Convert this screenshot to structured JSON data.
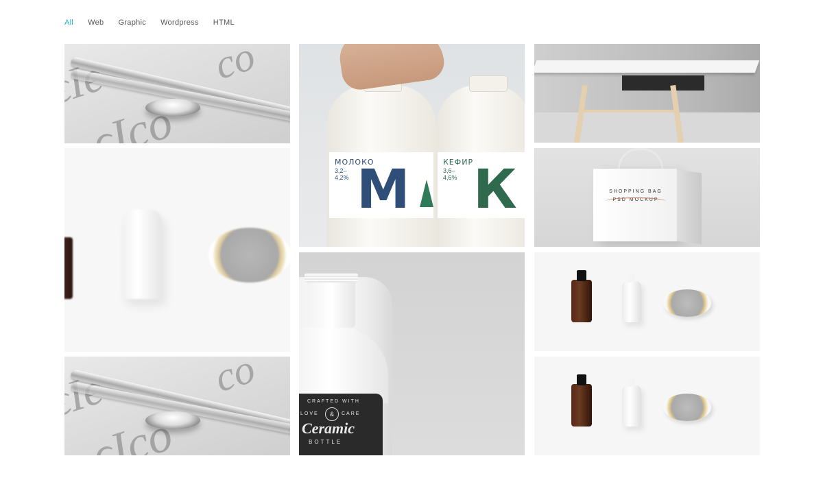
{
  "filters": [
    {
      "label": "All",
      "active": true
    },
    {
      "label": "Web",
      "active": false
    },
    {
      "label": "Graphic",
      "active": false
    },
    {
      "label": "Wordpress",
      "active": false
    },
    {
      "label": "HTML",
      "active": false
    }
  ],
  "colors": {
    "accent": "#1fb5c7",
    "filter_text": "#555555",
    "background": "#ffffff"
  },
  "portfolio": {
    "milk_left": {
      "name": "МОЛОКО",
      "percent": "3,2–\n4,2%",
      "letter": "М"
    },
    "milk_right": {
      "name": "КЕФИР",
      "percent": "3,6–\n4,6%",
      "letter": "К"
    },
    "bag_text": "SHOPPING BAG PSD MOCKUP",
    "ceramic": {
      "line1": "CRAFTED WITH",
      "amp": "&",
      "love": "LOVE",
      "care": "CARE",
      "script": "Ceramic",
      "bottle": "BOTTLE"
    }
  }
}
